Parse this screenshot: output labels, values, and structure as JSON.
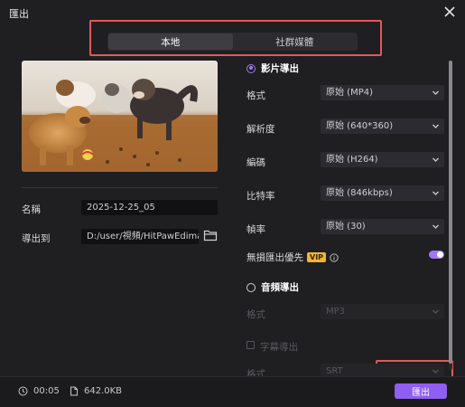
{
  "window": {
    "title": "匯出"
  },
  "tabs": [
    {
      "label": "本地",
      "active": true
    },
    {
      "label": "社群媒體",
      "active": false
    }
  ],
  "left": {
    "name_label": "名稱",
    "name_value": "2025-12-25_05",
    "export_to_label": "導出到",
    "export_to_value": "D:/user/視頻/HitPawEdimakor"
  },
  "video_export": {
    "title": "影片導出",
    "selected": true,
    "rows": [
      {
        "label": "格式",
        "value": "原始 (MP4)"
      },
      {
        "label": "解析度",
        "value": "原始 (640*360)"
      },
      {
        "label": "編碼",
        "value": "原始 (H264)"
      },
      {
        "label": "比特率",
        "value": "原始 (846kbps)"
      },
      {
        "label": "幀率",
        "value": "原始 (30)"
      }
    ],
    "lossless_label": "無損匯出優先",
    "vip_badge": "VIP",
    "lossless_on": true
  },
  "audio_export": {
    "title": "音頻導出",
    "selected": false,
    "format_label": "格式",
    "format_value": "MP3"
  },
  "subtitle_export": {
    "label": "字幕導出",
    "checked": false,
    "format_label": "格式",
    "format_value": "SRT"
  },
  "footer": {
    "duration": "00:05",
    "size": "642.0KB",
    "export_button": "匯出"
  },
  "colors": {
    "accent": "#8f5ef2",
    "highlight": "#e05a5a",
    "vip": "#f0b43a"
  }
}
